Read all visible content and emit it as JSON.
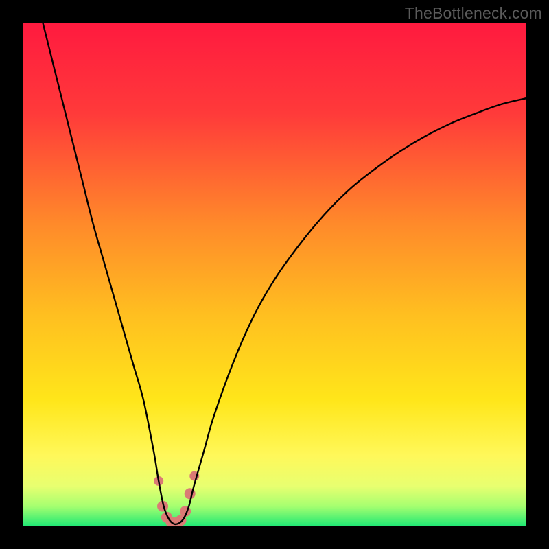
{
  "watermark": "TheBottleneck.com",
  "gradient_stops": [
    {
      "offset": 0.0,
      "color": "#ff1a3f"
    },
    {
      "offset": 0.18,
      "color": "#ff3a3a"
    },
    {
      "offset": 0.4,
      "color": "#ff8a2a"
    },
    {
      "offset": 0.58,
      "color": "#ffbf20"
    },
    {
      "offset": 0.75,
      "color": "#ffe61a"
    },
    {
      "offset": 0.86,
      "color": "#fff85a"
    },
    {
      "offset": 0.92,
      "color": "#e8ff70"
    },
    {
      "offset": 0.96,
      "color": "#a6ff70"
    },
    {
      "offset": 1.0,
      "color": "#1ee874"
    }
  ],
  "chart_data": {
    "type": "line",
    "title": "",
    "xlabel": "",
    "ylabel": "",
    "xlim": [
      0,
      100
    ],
    "ylim": [
      0,
      100
    ],
    "curve_minimum_x": 30,
    "series": [
      {
        "name": "bottleneck-curve",
        "x": [
          4,
          6,
          8,
          10,
          12,
          14,
          16,
          18,
          20,
          22,
          24,
          26,
          27,
          28,
          29,
          30,
          31,
          32,
          33,
          34,
          36,
          38,
          42,
          46,
          50,
          55,
          60,
          65,
          70,
          75,
          80,
          85,
          90,
          95,
          100
        ],
        "y": [
          100,
          92,
          84,
          76,
          68,
          60,
          53,
          46,
          39,
          32,
          25,
          15,
          9,
          4,
          1.5,
          0.5,
          0.6,
          1.6,
          4,
          8,
          15,
          22,
          33,
          42,
          49,
          56,
          62,
          67,
          71,
          74.5,
          77.5,
          80,
          82,
          83.8,
          85
        ]
      }
    ],
    "markers": {
      "name": "bottom-dots",
      "color": "#da7a75",
      "points": [
        {
          "x": 27.0,
          "y": 9.0,
          "r": 7
        },
        {
          "x": 27.8,
          "y": 4.0,
          "r": 8
        },
        {
          "x": 28.6,
          "y": 1.8,
          "r": 8
        },
        {
          "x": 29.5,
          "y": 0.8,
          "r": 8
        },
        {
          "x": 30.5,
          "y": 0.7,
          "r": 8
        },
        {
          "x": 31.4,
          "y": 1.2,
          "r": 8
        },
        {
          "x": 32.3,
          "y": 3.0,
          "r": 8
        },
        {
          "x": 33.2,
          "y": 6.5,
          "r": 8
        },
        {
          "x": 34.1,
          "y": 10.0,
          "r": 7
        }
      ]
    }
  }
}
